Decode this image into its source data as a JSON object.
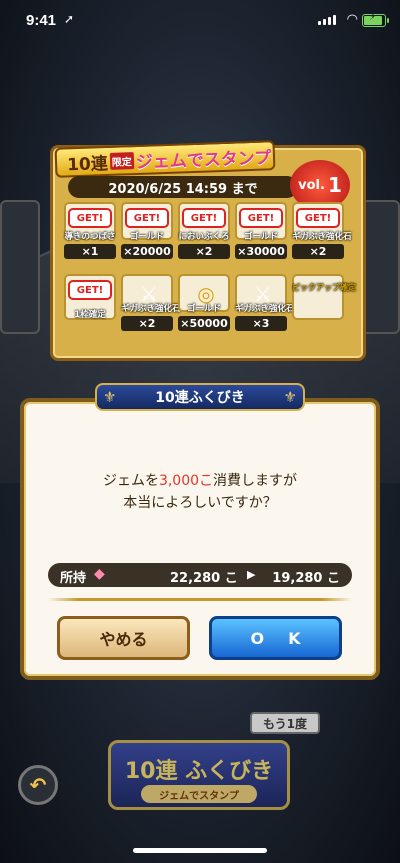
{
  "status_bar": {
    "time": "9:41",
    "location_arrow": "location-arrow-icon",
    "battery_color": "#7ad35c"
  },
  "campaign": {
    "title_prefix": "10連",
    "title_limited": "限定",
    "title_main": "ジェムでスタンプ",
    "period": "2020/6/25 14:59 まで",
    "vol_label": "vol.",
    "vol_number": "1"
  },
  "stamps": [
    {
      "name": "導きのつばさ",
      "qty": "×1",
      "get": "GET!",
      "icon": "wing-icon"
    },
    {
      "name": "ゴールド",
      "qty": "×20000",
      "get": "GET!",
      "icon": "gold-coin-icon"
    },
    {
      "name": "においぶくろ",
      "qty": "×2",
      "get": "GET!",
      "icon": "scent-bag-icon"
    },
    {
      "name": "ゴールド",
      "qty": "×30000",
      "get": "GET!",
      "icon": "gold-coin-icon"
    },
    {
      "name": "ギガぶき強化石",
      "qty": "×2",
      "get": "GET!",
      "icon": "giga-stone-icon"
    },
    {
      "name": "1枠確定",
      "qty": "",
      "get": "GET!",
      "icon": "ticket-icon"
    },
    {
      "name": "ギガぶき強化石",
      "qty": "×2",
      "get": "",
      "icon": "giga-stone-icon"
    },
    {
      "name": "ゴールド",
      "qty": "×50000",
      "get": "",
      "icon": "gold-coin-icon"
    },
    {
      "name": "ギガぶき強化石",
      "qty": "×3",
      "get": "",
      "icon": "giga-stone-icon"
    },
    {
      "name": "ピックアップ確定",
      "qty": "",
      "get": "",
      "icon": "pickup-icon"
    }
  ],
  "dialog": {
    "title": "10連ふくびき",
    "msg_before": "ジェムを",
    "msg_cost": "3,000こ",
    "msg_after": "消費しますが",
    "msg_line2": "本当によろしいですか？",
    "owned_label": "所持",
    "owned_before": "22,280 こ",
    "owned_after": "19,280 こ",
    "cancel": "やめる",
    "ok": "OK"
  },
  "bottom": {
    "again": "もう1度",
    "gacha_main": "10連 ふくびき",
    "gacha_sub": "ジェムでスタンプ",
    "back_icon": "back-arrow-icon"
  }
}
